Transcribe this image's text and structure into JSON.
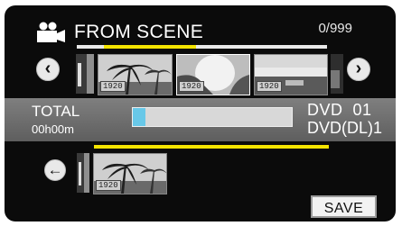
{
  "header": {
    "title": "FROM SCENE",
    "counter": "0/999",
    "icon": "video-camera-icon"
  },
  "strip": {
    "thumbnails": [
      {
        "label": ""
      },
      {
        "label": "1920"
      },
      {
        "label": "1920"
      },
      {
        "label": "1920"
      },
      {
        "label": ""
      }
    ],
    "prev_icon": "chevron-left-icon",
    "next_icon": "chevron-right-icon"
  },
  "info": {
    "total_label": "TOTAL",
    "total_time": "00h00m",
    "disc_type": "DVD  01",
    "disc_layer": "DVD(DL)1",
    "capacity_used_fraction": 0.08
  },
  "selected": {
    "back_icon": "arrow-left-icon",
    "thumbnails": [
      {
        "label": ""
      },
      {
        "label": "1920"
      }
    ]
  },
  "save_label": "SAVE",
  "colors": {
    "accent": "#f4e400",
    "capacity": "#68c8e8",
    "background": "#0b0b0b"
  }
}
